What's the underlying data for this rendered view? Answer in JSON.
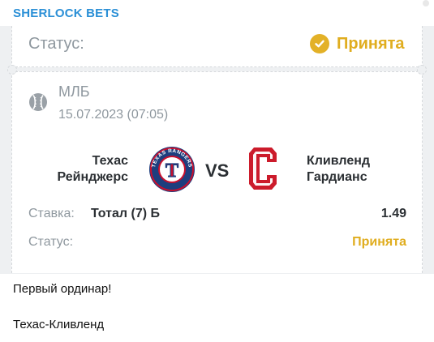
{
  "channel": {
    "name": "SHERLOCK BETS"
  },
  "ticket": {
    "status_label_top": "Статус:",
    "status_value_top": "Принята",
    "sport_icon": "baseball-icon",
    "league": "МЛБ",
    "datetime": "15.07.2023 (07:05)",
    "home_team": "Техас Рейнджерс",
    "away_team": "Кливленд Гардианс",
    "vs": "VS",
    "home_logo_text": "TEXAS RANGERS",
    "home_logo_letter": "T",
    "away_logo_letter": "C",
    "bet_label": "Ставка:",
    "bet_value": "Тотал (7) Б",
    "odds": "1.49",
    "status_label": "Статус:",
    "status_value": "Принята"
  },
  "message": {
    "line1": "Первый ординар!",
    "line2": "Техас-Кливленд"
  },
  "colors": {
    "channel": "#2a8fd6",
    "accent_gold": "#e0ad1f",
    "muted": "#8f989f",
    "ticket_bg": "#eef0f2",
    "rangers_blue": "#1d3e7e",
    "rangers_red": "#c8102e",
    "guardians_red": "#cc1b2b"
  }
}
